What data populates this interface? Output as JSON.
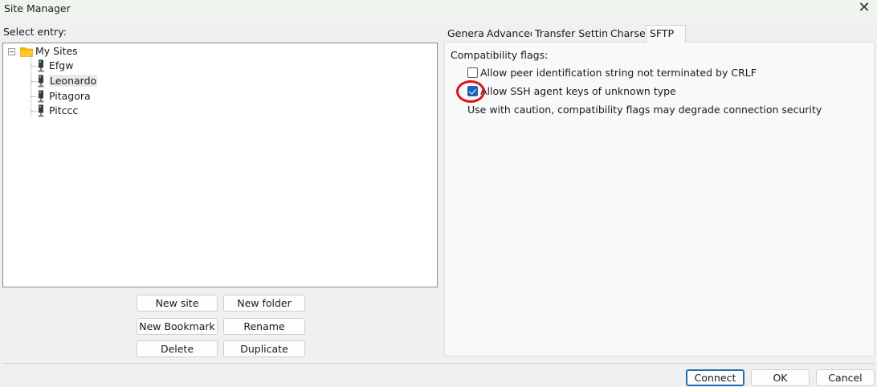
{
  "window": {
    "title": "Site Manager",
    "close_glyph": "✕"
  },
  "left_panel": {
    "select_label": "Select entry:",
    "tree": {
      "root": "My Sites",
      "items": [
        {
          "label": "Efgw",
          "selected": false
        },
        {
          "label": "Leonardo",
          "selected": true
        },
        {
          "label": "Pitagora",
          "selected": false
        },
        {
          "label": "Pitccc",
          "selected": false
        }
      ]
    },
    "buttons": {
      "new_site": "New site",
      "new_folder": "New folder",
      "new_bookmark": "New Bookmark",
      "rename": "Rename",
      "delete": "Delete",
      "duplicate": "Duplicate"
    }
  },
  "tabs": [
    {
      "label": "General",
      "active": false
    },
    {
      "label": "Advanced",
      "active": false
    },
    {
      "label": "Transfer Settings",
      "active": false
    },
    {
      "label": "Charset",
      "active": false
    },
    {
      "label": "SFTP",
      "active": true
    }
  ],
  "sftp": {
    "compat_label": "Compatibility flags:",
    "flags": [
      {
        "label": "Allow peer identification string not terminated by CRLF",
        "checked": false
      },
      {
        "label": "Allow SSH agent keys of unknown type",
        "checked": true
      }
    ],
    "warning": "Use with caution, compatibility flags may degrade connection security"
  },
  "footer": {
    "connect": "Connect",
    "ok": "OK",
    "cancel": "Cancel"
  },
  "icons": {
    "folder": "folder-icon",
    "site": "server-icon",
    "close": "close-icon",
    "checkmark": "checkmark-icon"
  },
  "colors": {
    "titlebar": "#eef5ec",
    "accent": "#1f62b6",
    "annotation": "#d7151b",
    "folder": "#f5b800"
  }
}
